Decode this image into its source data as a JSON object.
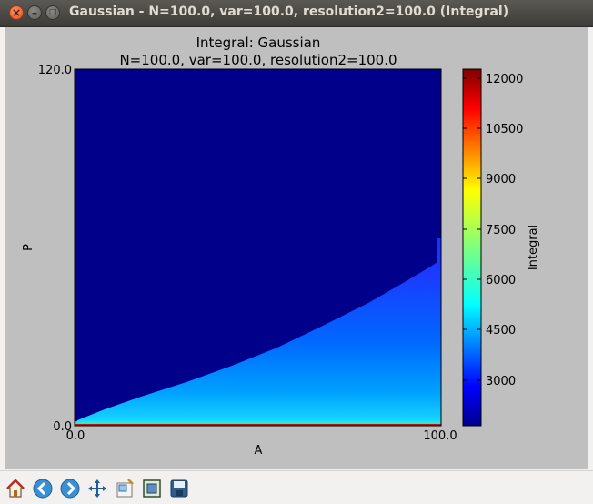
{
  "window": {
    "title": "Gaussian - N=100.0, var=100.0, resolution2=100.0 (Integral)"
  },
  "plot": {
    "title_line1": "Integral: Gaussian",
    "title_line2": "N=100.0, var=100.0, resolution2=100.0",
    "xlabel": "A",
    "ylabel": "P",
    "x_min_label": "0.0",
    "x_max_label": "100.0",
    "y_min_label": "0.0",
    "y_max_label": "120.0",
    "colorbar_label": "Integral",
    "colorbar_ticks": [
      "12000",
      "10500",
      "9000",
      "7500",
      "6000",
      "4500",
      "3000"
    ],
    "background_color": "#00008b",
    "colormap": "jet"
  },
  "toolbar": {
    "buttons": [
      {
        "name": "home-icon"
      },
      {
        "name": "back-arrow-icon"
      },
      {
        "name": "forward-arrow-icon"
      },
      {
        "name": "pan-icon"
      },
      {
        "name": "zoom-icon"
      },
      {
        "name": "subplots-icon"
      },
      {
        "name": "save-icon"
      }
    ]
  }
}
